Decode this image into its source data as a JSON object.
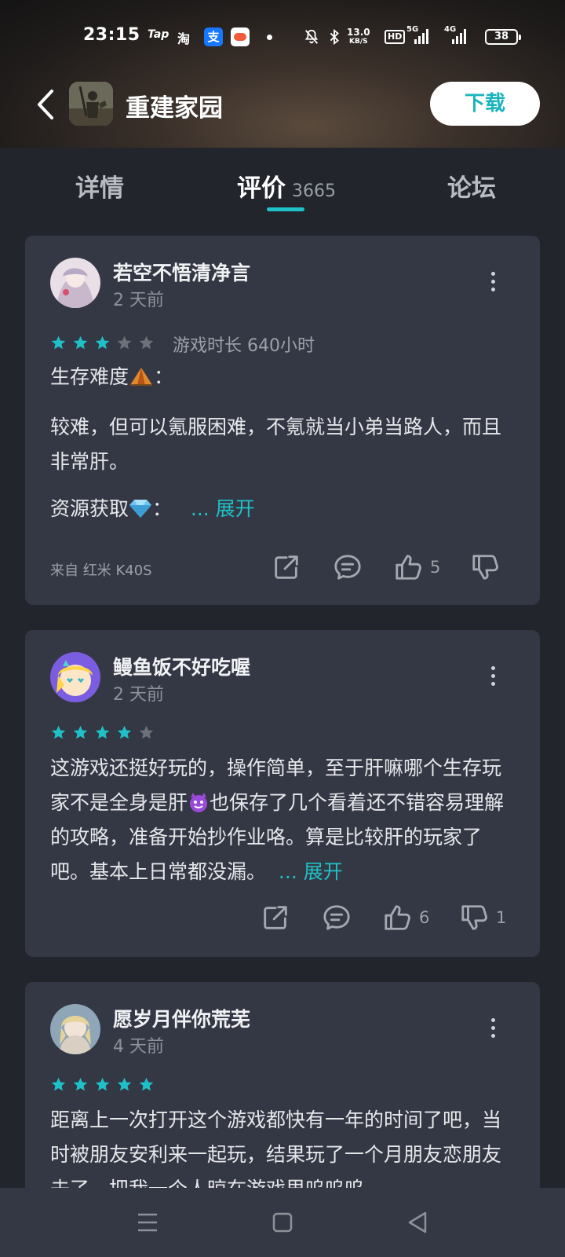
{
  "status_bar": {
    "time": "23:15",
    "apps": [
      "Tap",
      "淘",
      "支"
    ],
    "net_speed": "13.0",
    "net_speed_unit": "KB/S",
    "hd": "HD",
    "net_5g": "5G",
    "net_4g": "4G",
    "battery": "38"
  },
  "header": {
    "game_title": "重建家园",
    "download_label": "下载"
  },
  "tabs": {
    "detail": "详情",
    "review": "评价",
    "review_count": "3665",
    "forum": "论坛"
  },
  "colors": {
    "accent": "#1fc1c8",
    "card_bg": "#343844",
    "page_bg": "#22252c",
    "star_off": "#6d717a"
  },
  "reviews": [
    {
      "user": "若空不悟清净言",
      "time": "2 天前",
      "rating": 3,
      "playtime": "游戏时长 640小时",
      "para1": "生存难度",
      "para1_suffix": "：",
      "para2": "较难，但可以氪服困难，不氪就当小弟当路人，而且非常肝。",
      "para3": "资源获取",
      "para3_suffix": "：",
      "expand": "... 展开",
      "device": "来自 红米 K40S",
      "likes": "5",
      "dislikes": ""
    },
    {
      "user": "鳗鱼饭不好吃喔",
      "time": "2 天前",
      "rating": 4,
      "text_a": "这游戏还挺好玩的，操作简单，至于肝嘛哪个生存玩家不是全身是肝",
      "text_b": "也保存了几个看着还不错容易理解的攻略，准备开始抄作业咯。算是比较肝的玩家了吧。基本上日常都没漏。",
      "expand": "... 展开",
      "likes": "6",
      "dislikes": "1"
    },
    {
      "user": "愿岁月伴你荒芜",
      "time": "4 天前",
      "rating": 5,
      "text": "距离上一次打开这个游戏都快有一年的时间了吧，当时被朋友安利来一起玩，结果玩了一个月朋友恋朋友去了，把我一个人晾在游戏里呜呜呜"
    }
  ],
  "icons": {
    "back": "back-arrow-icon",
    "share": "share-icon",
    "comment": "comment-icon",
    "like": "thumbs-up-icon",
    "dislike": "thumbs-down-icon",
    "more": "more-vertical-icon",
    "nav_menu": "menu-icon",
    "nav_home": "home-square-icon",
    "nav_back": "back-triangle-icon"
  }
}
